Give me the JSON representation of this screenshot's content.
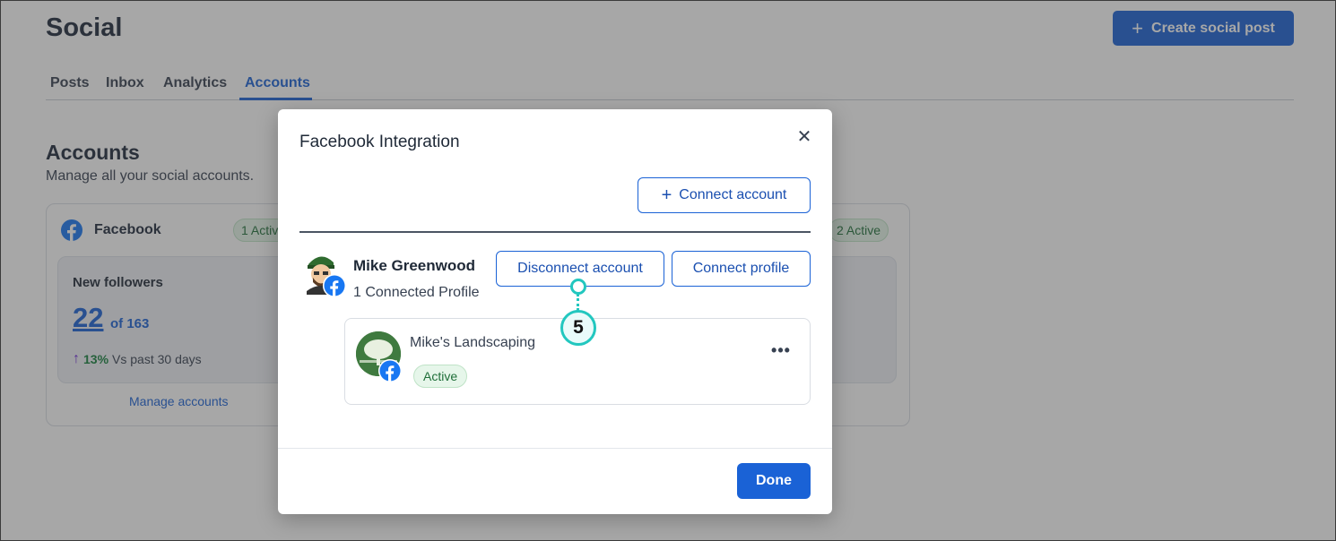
{
  "page": {
    "title": "Social",
    "create_button": "Create social post",
    "tabs": [
      {
        "label": "Posts"
      },
      {
        "label": "Inbox"
      },
      {
        "label": "Analytics"
      },
      {
        "label": "Accounts",
        "active": true
      }
    ],
    "section_title": "Accounts",
    "section_subtitle": "Manage all your social accounts.",
    "facebook_card": {
      "title": "Facebook",
      "badge_left": "1 Active",
      "badge_right": "2 Active",
      "stat_label": "New followers",
      "stat_value": "22",
      "stat_of": "of 163",
      "trend_pct": "13%",
      "trend_text": "Vs past 30 days",
      "manage_link": "Manage accounts"
    }
  },
  "modal": {
    "title": "Facebook Integration",
    "connect_account_button": "Connect account",
    "account": {
      "name": "Mike Greenwood",
      "subtitle": "1 Connected Profile",
      "disconnect_button": "Disconnect account",
      "connect_profile_button": "Connect profile"
    },
    "profile": {
      "name": "Mike's Landscaping",
      "status": "Active"
    },
    "done_button": "Done"
  },
  "callout": {
    "number": "5"
  },
  "colors": {
    "brand": "#1a62d6",
    "facebook": "#1877f2",
    "active_green": "#1f6f39",
    "callout_teal": "#22c7bf"
  },
  "icons": {
    "close": "close-icon",
    "plus": "plus-icon",
    "more": "more-horizontal-icon",
    "facebook": "facebook-icon",
    "trend": "arrow-up-icon"
  }
}
